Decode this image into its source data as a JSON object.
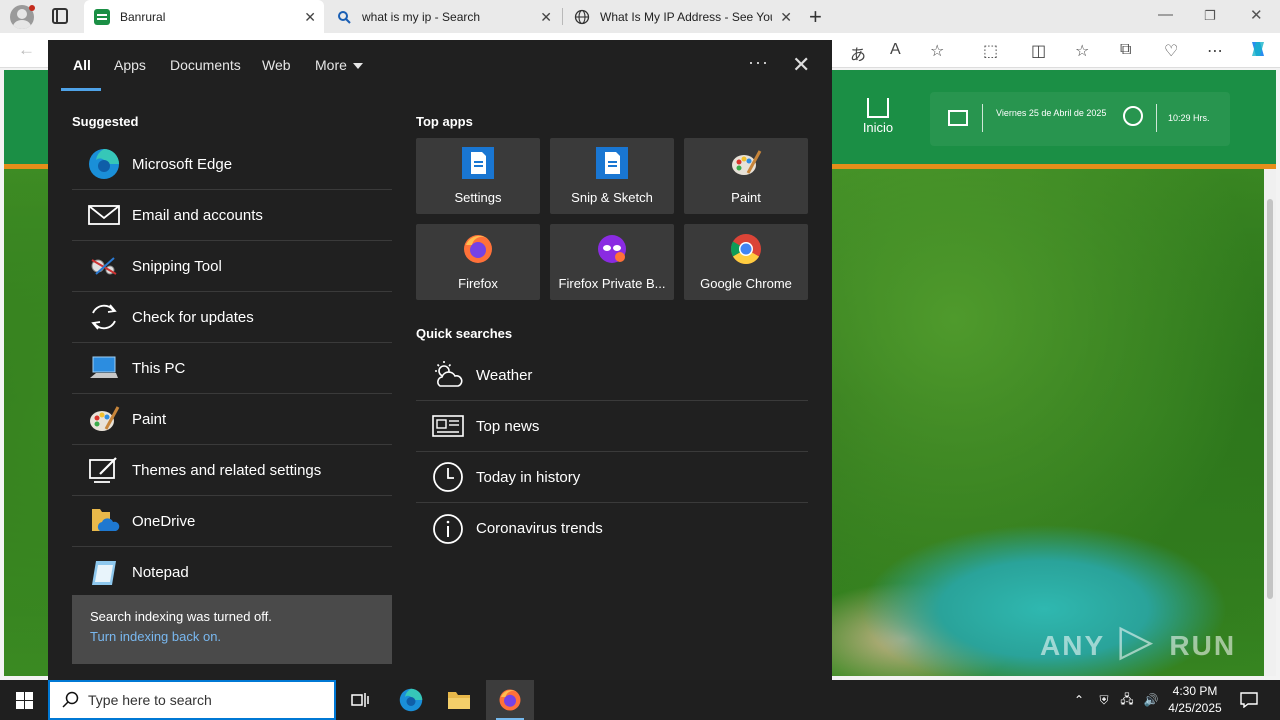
{
  "browser": {
    "tabs": [
      {
        "title": "Banrural",
        "active": true
      },
      {
        "title": "what is my ip - Search",
        "active": false
      },
      {
        "title": "What Is My IP Address - See Your",
        "active": false
      }
    ],
    "accent": "#0078d4"
  },
  "page": {
    "nav_inicio": "Inicio",
    "date": "Viernes 25 de Abril de 2025",
    "time": "10:29 Hrs.",
    "watermark_a": "ANY",
    "watermark_b": "RUN",
    "brand_color": "#1b8f45",
    "stripe_color": "#e58e1a"
  },
  "panel": {
    "tabs": [
      "All",
      "Apps",
      "Documents",
      "Web",
      "More"
    ],
    "active_tab": "All",
    "suggested_title": "Suggested",
    "suggested": [
      {
        "label": "Microsoft Edge",
        "icon": "edge-icon"
      },
      {
        "label": "Email and accounts",
        "icon": "mail-icon"
      },
      {
        "label": "Snipping Tool",
        "icon": "snipping-tool-icon"
      },
      {
        "label": "Check for updates",
        "icon": "refresh-icon"
      },
      {
        "label": "This PC",
        "icon": "computer-icon"
      },
      {
        "label": "Paint",
        "icon": "paint-icon"
      },
      {
        "label": "Themes and related settings",
        "icon": "themes-icon"
      },
      {
        "label": "OneDrive",
        "icon": "onedrive-icon"
      },
      {
        "label": "Notepad",
        "icon": "notepad-icon"
      }
    ],
    "notice": {
      "text": "Search indexing was turned off.",
      "link": "Turn indexing back on."
    },
    "top_apps_title": "Top apps",
    "top_apps": [
      {
        "label": "Settings",
        "icon": "settings-doc-icon"
      },
      {
        "label": "Snip & Sketch",
        "icon": "snip-sketch-icon"
      },
      {
        "label": "Paint",
        "icon": "paint-icon"
      },
      {
        "label": "Firefox",
        "icon": "firefox-icon"
      },
      {
        "label": "Firefox Private B...",
        "icon": "firefox-private-icon"
      },
      {
        "label": "Google Chrome",
        "icon": "chrome-icon"
      }
    ],
    "quick_searches_title": "Quick searches",
    "quick_searches": [
      {
        "label": "Weather",
        "icon": "weather-icon"
      },
      {
        "label": "Top news",
        "icon": "news-icon"
      },
      {
        "label": "Today in history",
        "icon": "clock-icon"
      },
      {
        "label": "Coronavirus trends",
        "icon": "info-icon"
      }
    ]
  },
  "taskbar": {
    "search_placeholder": "Type here to search",
    "time": "4:30 PM",
    "date": "4/25/2025"
  }
}
